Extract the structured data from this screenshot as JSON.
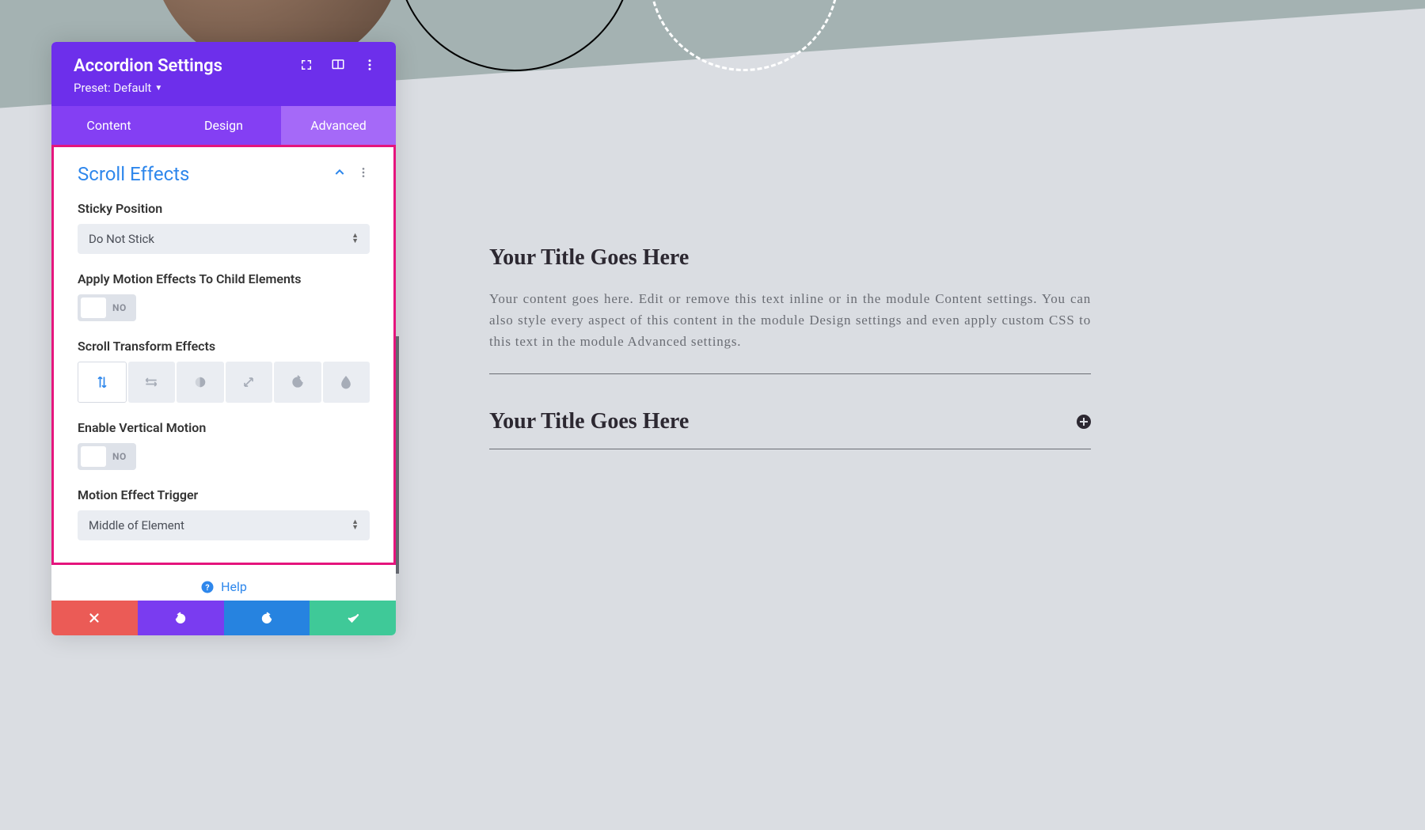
{
  "panel": {
    "title": "Accordion Settings",
    "preset": "Preset: Default"
  },
  "tabs": {
    "content": "Content",
    "design": "Design",
    "advanced": "Advanced"
  },
  "section": {
    "title": "Scroll Effects"
  },
  "fields": {
    "sticky_label": "Sticky Position",
    "sticky_value": "Do Not Stick",
    "child_motion_label": "Apply Motion Effects To Child Elements",
    "child_motion_value": "NO",
    "transform_label": "Scroll Transform Effects",
    "vertical_label": "Enable Vertical Motion",
    "vertical_value": "NO",
    "trigger_label": "Motion Effect Trigger",
    "trigger_value": "Middle of Element"
  },
  "help_label": "Help",
  "preview": {
    "title1": "Your Title Goes Here",
    "body1": "Your content goes here. Edit or remove this text inline or in the module Content settings. You can also style every aspect of this content in the module Design settings and even apply custom CSS to this text in the module Advanced settings.",
    "title2": "Your Title Goes Here"
  }
}
